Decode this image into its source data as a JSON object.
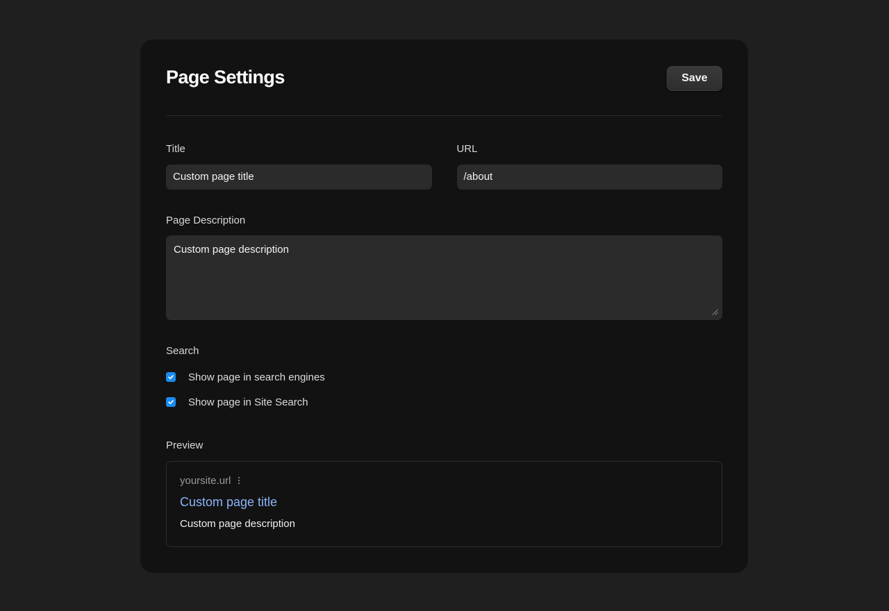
{
  "header": {
    "title": "Page Settings",
    "save_label": "Save"
  },
  "fields": {
    "title_label": "Title",
    "title_value": "Custom page title",
    "url_label": "URL",
    "url_value": "/about",
    "description_label": "Page Description",
    "description_value": "Custom page description"
  },
  "search": {
    "label": "Search",
    "options": [
      {
        "label": "Show page in search engines",
        "checked": true
      },
      {
        "label": "Show page in Site Search",
        "checked": true
      }
    ]
  },
  "preview": {
    "label": "Preview",
    "site": "yoursite.url",
    "title": "Custom page title",
    "description": "Custom page description"
  },
  "colors": {
    "background": "#1f1f1f",
    "panel": "#121212",
    "input": "#2b2b2b",
    "checkbox": "#1a8cf0",
    "link": "#8ab4f8"
  }
}
